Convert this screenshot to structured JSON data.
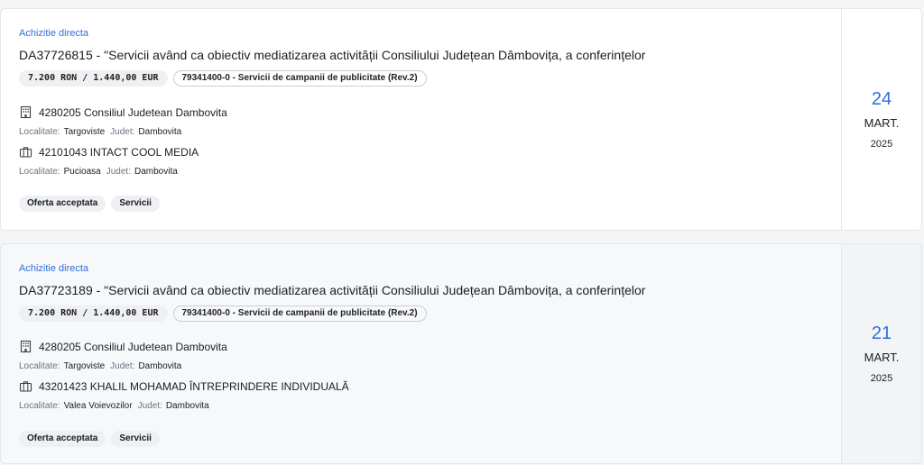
{
  "cards": [
    {
      "procedure_type": "Achizitie directa",
      "title": "DA37726815 - \"Servicii având ca obiectiv mediatizarea activității Consiliului Județean Dâmbovița, a conferințelor",
      "value": "7.200 RON / 1.440,00 EUR",
      "cpv": "79341400-0 - Servicii de campanii de publicitate (Rev.2)",
      "authority": {
        "icon": "building-icon",
        "name": "4280205 Consiliul Judetean Dambovita",
        "loc_label": "Localitate:",
        "loc": "Targoviste",
        "county_label": "Judet:",
        "county": "Dambovita"
      },
      "supplier": {
        "icon": "briefcase-icon",
        "name": "42101043 INTACT COOL MEDIA",
        "loc_label": "Localitate:",
        "loc": "Pucioasa",
        "county_label": "Judet:",
        "county": "Dambovita"
      },
      "tags": [
        "Oferta acceptata",
        "Servicii"
      ],
      "date": {
        "day": "24",
        "month": "MART.",
        "year": "2025"
      }
    },
    {
      "procedure_type": "Achizitie directa",
      "title": "DA37723189 - \"Servicii având ca obiectiv mediatizarea activității Consiliului Județean Dâmbovița, a conferințelor",
      "value": "7.200 RON / 1.440,00 EUR",
      "cpv": "79341400-0 - Servicii de campanii de publicitate (Rev.2)",
      "authority": {
        "icon": "building-icon",
        "name": "4280205 Consiliul Judetean Dambovita",
        "loc_label": "Localitate:",
        "loc": "Targoviste",
        "county_label": "Judet:",
        "county": "Dambovita"
      },
      "supplier": {
        "icon": "briefcase-icon",
        "name": "43201423 KHALIL MOHAMAD ÎNTREPRINDERE INDIVIDUALĂ",
        "loc_label": "Localitate:",
        "loc": "Valea Voievozilor",
        "county_label": "Judet:",
        "county": "Dambovita"
      },
      "tags": [
        "Oferta acceptata",
        "Servicii"
      ],
      "date": {
        "day": "21",
        "month": "MART.",
        "year": "2025"
      }
    }
  ]
}
